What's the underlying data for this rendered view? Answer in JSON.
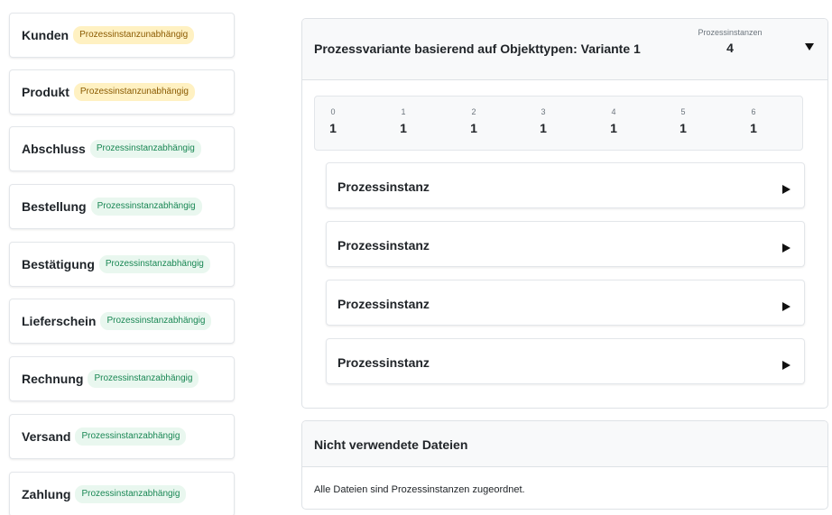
{
  "object_types": [
    {
      "name": "Kunden",
      "badge": "Prozessinstanzunabhängig",
      "badge_color": "#fff1c2"
    },
    {
      "name": "Produkt",
      "badge": "Prozessinstanzunabhängig",
      "badge_color": "#fff1c2"
    },
    {
      "name": "Abschluss",
      "badge": "Prozessinstanzabhängig",
      "badge_color": "#e9f7ef"
    },
    {
      "name": "Bestellung",
      "badge": "Prozessinstanzabhängig",
      "badge_color": "#e9f7ef"
    },
    {
      "name": "Bestätigung",
      "badge": "Prozessinstanzabhängig",
      "badge_color": "#e9f7ef"
    },
    {
      "name": "Lieferschein",
      "badge": "Prozessinstanzabhängig",
      "badge_color": "#e9f7ef"
    },
    {
      "name": "Rechnung",
      "badge": "Prozessinstanzabhängig",
      "badge_color": "#e9f7ef"
    },
    {
      "name": "Versand",
      "badge": "Prozessinstanzabhängig",
      "badge_color": "#e9f7ef"
    },
    {
      "name": "Zahlung",
      "badge": "Prozessinstanzabhängig",
      "badge_color": "#e9f7ef"
    }
  ],
  "variant": {
    "title": "Prozessvariante basierend auf Objekttypen: Variante 1",
    "instances_label": "Prozessinstanzen",
    "instances_count": "4",
    "toggle_icon": "caret-down-icon",
    "steps": [
      {
        "index": "0",
        "value": "1"
      },
      {
        "index": "1",
        "value": "1"
      },
      {
        "index": "2",
        "value": "1"
      },
      {
        "index": "3",
        "value": "1"
      },
      {
        "index": "4",
        "value": "1"
      },
      {
        "index": "5",
        "value": "1"
      },
      {
        "index": "6",
        "value": "1"
      }
    ],
    "instances": [
      {
        "label": "Prozessinstanz",
        "icon": "caret-right-icon"
      },
      {
        "label": "Prozessinstanz",
        "icon": "caret-right-icon"
      },
      {
        "label": "Prozessinstanz",
        "icon": "caret-right-icon"
      },
      {
        "label": "Prozessinstanz",
        "icon": "caret-right-icon"
      }
    ]
  },
  "unused_files": {
    "title": "Nicht verwendete Dateien",
    "message": "Alle Dateien sind Prozessinstanzen zugeordnet."
  },
  "colors": {
    "accent_green_text": "#198754",
    "accent_yellow_text": "#8a5a00",
    "panel_header_bg": "#f8f9fa",
    "border": "#dee2e6"
  }
}
